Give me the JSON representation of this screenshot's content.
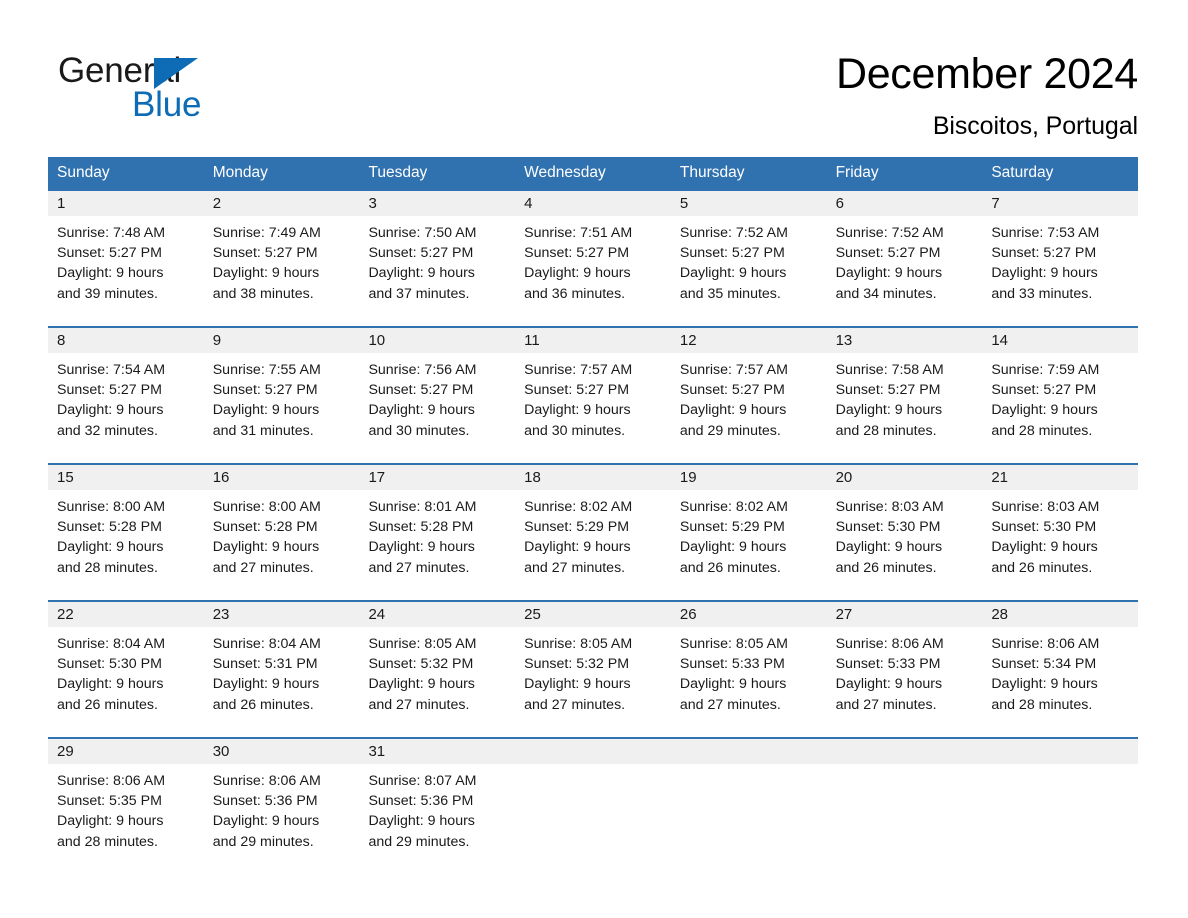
{
  "brand": {
    "name_part1": "General",
    "name_part2": "Blue",
    "triangle_color": "#0d6cb5",
    "accent_color": "#3071B0"
  },
  "header": {
    "month_title": "December 2024",
    "location": "Biscoitos, Portugal"
  },
  "calendar": {
    "weekday_headers": [
      "Sunday",
      "Monday",
      "Tuesday",
      "Wednesday",
      "Thursday",
      "Friday",
      "Saturday"
    ],
    "header_bg": "#3071B0",
    "daynum_bg": "#f0f0f0",
    "weeks": [
      {
        "days": [
          {
            "num": "1",
            "sunrise": "Sunrise: 7:48 AM",
            "sunset": "Sunset: 5:27 PM",
            "daylight_1": "Daylight: 9 hours",
            "daylight_2": "and 39 minutes."
          },
          {
            "num": "2",
            "sunrise": "Sunrise: 7:49 AM",
            "sunset": "Sunset: 5:27 PM",
            "daylight_1": "Daylight: 9 hours",
            "daylight_2": "and 38 minutes."
          },
          {
            "num": "3",
            "sunrise": "Sunrise: 7:50 AM",
            "sunset": "Sunset: 5:27 PM",
            "daylight_1": "Daylight: 9 hours",
            "daylight_2": "and 37 minutes."
          },
          {
            "num": "4",
            "sunrise": "Sunrise: 7:51 AM",
            "sunset": "Sunset: 5:27 PM",
            "daylight_1": "Daylight: 9 hours",
            "daylight_2": "and 36 minutes."
          },
          {
            "num": "5",
            "sunrise": "Sunrise: 7:52 AM",
            "sunset": "Sunset: 5:27 PM",
            "daylight_1": "Daylight: 9 hours",
            "daylight_2": "and 35 minutes."
          },
          {
            "num": "6",
            "sunrise": "Sunrise: 7:52 AM",
            "sunset": "Sunset: 5:27 PM",
            "daylight_1": "Daylight: 9 hours",
            "daylight_2": "and 34 minutes."
          },
          {
            "num": "7",
            "sunrise": "Sunrise: 7:53 AM",
            "sunset": "Sunset: 5:27 PM",
            "daylight_1": "Daylight: 9 hours",
            "daylight_2": "and 33 minutes."
          }
        ]
      },
      {
        "days": [
          {
            "num": "8",
            "sunrise": "Sunrise: 7:54 AM",
            "sunset": "Sunset: 5:27 PM",
            "daylight_1": "Daylight: 9 hours",
            "daylight_2": "and 32 minutes."
          },
          {
            "num": "9",
            "sunrise": "Sunrise: 7:55 AM",
            "sunset": "Sunset: 5:27 PM",
            "daylight_1": "Daylight: 9 hours",
            "daylight_2": "and 31 minutes."
          },
          {
            "num": "10",
            "sunrise": "Sunrise: 7:56 AM",
            "sunset": "Sunset: 5:27 PM",
            "daylight_1": "Daylight: 9 hours",
            "daylight_2": "and 30 minutes."
          },
          {
            "num": "11",
            "sunrise": "Sunrise: 7:57 AM",
            "sunset": "Sunset: 5:27 PM",
            "daylight_1": "Daylight: 9 hours",
            "daylight_2": "and 30 minutes."
          },
          {
            "num": "12",
            "sunrise": "Sunrise: 7:57 AM",
            "sunset": "Sunset: 5:27 PM",
            "daylight_1": "Daylight: 9 hours",
            "daylight_2": "and 29 minutes."
          },
          {
            "num": "13",
            "sunrise": "Sunrise: 7:58 AM",
            "sunset": "Sunset: 5:27 PM",
            "daylight_1": "Daylight: 9 hours",
            "daylight_2": "and 28 minutes."
          },
          {
            "num": "14",
            "sunrise": "Sunrise: 7:59 AM",
            "sunset": "Sunset: 5:27 PM",
            "daylight_1": "Daylight: 9 hours",
            "daylight_2": "and 28 minutes."
          }
        ]
      },
      {
        "days": [
          {
            "num": "15",
            "sunrise": "Sunrise: 8:00 AM",
            "sunset": "Sunset: 5:28 PM",
            "daylight_1": "Daylight: 9 hours",
            "daylight_2": "and 28 minutes."
          },
          {
            "num": "16",
            "sunrise": "Sunrise: 8:00 AM",
            "sunset": "Sunset: 5:28 PM",
            "daylight_1": "Daylight: 9 hours",
            "daylight_2": "and 27 minutes."
          },
          {
            "num": "17",
            "sunrise": "Sunrise: 8:01 AM",
            "sunset": "Sunset: 5:28 PM",
            "daylight_1": "Daylight: 9 hours",
            "daylight_2": "and 27 minutes."
          },
          {
            "num": "18",
            "sunrise": "Sunrise: 8:02 AM",
            "sunset": "Sunset: 5:29 PM",
            "daylight_1": "Daylight: 9 hours",
            "daylight_2": "and 27 minutes."
          },
          {
            "num": "19",
            "sunrise": "Sunrise: 8:02 AM",
            "sunset": "Sunset: 5:29 PM",
            "daylight_1": "Daylight: 9 hours",
            "daylight_2": "and 26 minutes."
          },
          {
            "num": "20",
            "sunrise": "Sunrise: 8:03 AM",
            "sunset": "Sunset: 5:30 PM",
            "daylight_1": "Daylight: 9 hours",
            "daylight_2": "and 26 minutes."
          },
          {
            "num": "21",
            "sunrise": "Sunrise: 8:03 AM",
            "sunset": "Sunset: 5:30 PM",
            "daylight_1": "Daylight: 9 hours",
            "daylight_2": "and 26 minutes."
          }
        ]
      },
      {
        "days": [
          {
            "num": "22",
            "sunrise": "Sunrise: 8:04 AM",
            "sunset": "Sunset: 5:30 PM",
            "daylight_1": "Daylight: 9 hours",
            "daylight_2": "and 26 minutes."
          },
          {
            "num": "23",
            "sunrise": "Sunrise: 8:04 AM",
            "sunset": "Sunset: 5:31 PM",
            "daylight_1": "Daylight: 9 hours",
            "daylight_2": "and 26 minutes."
          },
          {
            "num": "24",
            "sunrise": "Sunrise: 8:05 AM",
            "sunset": "Sunset: 5:32 PM",
            "daylight_1": "Daylight: 9 hours",
            "daylight_2": "and 27 minutes."
          },
          {
            "num": "25",
            "sunrise": "Sunrise: 8:05 AM",
            "sunset": "Sunset: 5:32 PM",
            "daylight_1": "Daylight: 9 hours",
            "daylight_2": "and 27 minutes."
          },
          {
            "num": "26",
            "sunrise": "Sunrise: 8:05 AM",
            "sunset": "Sunset: 5:33 PM",
            "daylight_1": "Daylight: 9 hours",
            "daylight_2": "and 27 minutes."
          },
          {
            "num": "27",
            "sunrise": "Sunrise: 8:06 AM",
            "sunset": "Sunset: 5:33 PM",
            "daylight_1": "Daylight: 9 hours",
            "daylight_2": "and 27 minutes."
          },
          {
            "num": "28",
            "sunrise": "Sunrise: 8:06 AM",
            "sunset": "Sunset: 5:34 PM",
            "daylight_1": "Daylight: 9 hours",
            "daylight_2": "and 28 minutes."
          }
        ]
      },
      {
        "days": [
          {
            "num": "29",
            "sunrise": "Sunrise: 8:06 AM",
            "sunset": "Sunset: 5:35 PM",
            "daylight_1": "Daylight: 9 hours",
            "daylight_2": "and 28 minutes."
          },
          {
            "num": "30",
            "sunrise": "Sunrise: 8:06 AM",
            "sunset": "Sunset: 5:36 PM",
            "daylight_1": "Daylight: 9 hours",
            "daylight_2": "and 29 minutes."
          },
          {
            "num": "31",
            "sunrise": "Sunrise: 8:07 AM",
            "sunset": "Sunset: 5:36 PM",
            "daylight_1": "Daylight: 9 hours",
            "daylight_2": "and 29 minutes."
          },
          {
            "num": "",
            "sunrise": "",
            "sunset": "",
            "daylight_1": "",
            "daylight_2": ""
          },
          {
            "num": "",
            "sunrise": "",
            "sunset": "",
            "daylight_1": "",
            "daylight_2": ""
          },
          {
            "num": "",
            "sunrise": "",
            "sunset": "",
            "daylight_1": "",
            "daylight_2": ""
          },
          {
            "num": "",
            "sunrise": "",
            "sunset": "",
            "daylight_1": "",
            "daylight_2": ""
          }
        ]
      }
    ]
  }
}
